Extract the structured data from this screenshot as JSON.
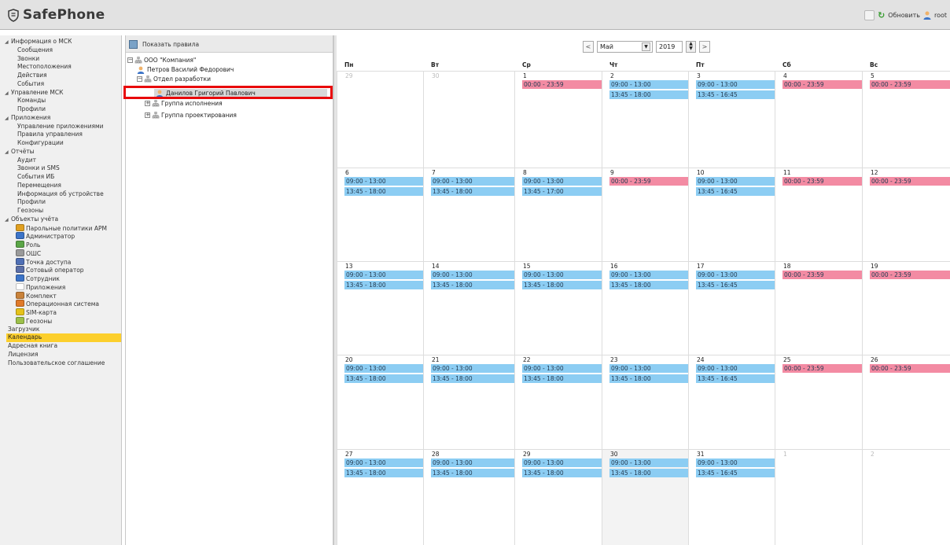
{
  "app": {
    "title": "SafePhone"
  },
  "header": {
    "refresh_label": "Обновить",
    "user_label": "root"
  },
  "nav": {
    "items": [
      {
        "label": "Информация о МСК",
        "kind": "section"
      },
      {
        "label": "Сообщения",
        "kind": "child"
      },
      {
        "label": "Звонки",
        "kind": "child"
      },
      {
        "label": "Местоположения",
        "kind": "child"
      },
      {
        "label": "Действия",
        "kind": "child"
      },
      {
        "label": "События",
        "kind": "child"
      },
      {
        "label": "Управление МСК",
        "kind": "section"
      },
      {
        "label": "Команды",
        "kind": "child"
      },
      {
        "label": "Профили",
        "kind": "child"
      },
      {
        "label": "Приложения",
        "kind": "section"
      },
      {
        "label": "Управление приложениями",
        "kind": "child"
      },
      {
        "label": "Правила управления",
        "kind": "child"
      },
      {
        "label": "Конфигурации",
        "kind": "child"
      },
      {
        "label": "Отчёты",
        "kind": "section"
      },
      {
        "label": "Аудит",
        "kind": "child"
      },
      {
        "label": "Звонки и SMS",
        "kind": "child"
      },
      {
        "label": "События ИБ",
        "kind": "child"
      },
      {
        "label": "Перемещения",
        "kind": "child"
      },
      {
        "label": "Информация об устройстве",
        "kind": "child"
      },
      {
        "label": "Профили",
        "kind": "child"
      },
      {
        "label": "Геозоны",
        "kind": "child"
      },
      {
        "label": "Объекты учёта",
        "kind": "section"
      },
      {
        "label": "Парольные политики АРМ",
        "kind": "child-icon",
        "icon": "lock-icon"
      },
      {
        "label": "Администратор",
        "kind": "child-icon",
        "icon": "admin-icon"
      },
      {
        "label": "Роль",
        "kind": "child-icon",
        "icon": "role-icon"
      },
      {
        "label": "ОШС",
        "kind": "child-icon",
        "icon": "org-structure-icon"
      },
      {
        "label": "Точка доступа",
        "kind": "child-icon",
        "icon": "access-point-icon"
      },
      {
        "label": "Сотовый оператор",
        "kind": "child-icon",
        "icon": "cell-operator-icon"
      },
      {
        "label": "Сотрудник",
        "kind": "child-icon",
        "icon": "employee-icon"
      },
      {
        "label": "Приложения",
        "kind": "child-icon",
        "icon": "application-icon"
      },
      {
        "label": "Комплект",
        "kind": "child-icon",
        "icon": "kit-icon"
      },
      {
        "label": "Операционная система",
        "kind": "child-icon",
        "icon": "os-icon"
      },
      {
        "label": "SIM-карта",
        "kind": "child-icon",
        "icon": "sim-card-icon"
      },
      {
        "label": "Геозоны",
        "kind": "child-icon",
        "icon": "geozone-icon"
      },
      {
        "label": "Загрузчик",
        "kind": "top"
      },
      {
        "label": "Календарь",
        "kind": "top",
        "active": true
      },
      {
        "label": "Адресная книга",
        "kind": "top"
      },
      {
        "label": "Лицензия",
        "kind": "top"
      },
      {
        "label": "Пользовательское соглашение",
        "kind": "top"
      }
    ]
  },
  "tree": {
    "show_rules_label": "Показать правила",
    "nodes": [
      {
        "label": "ООО \"Компания\"",
        "type": "org",
        "expander": "⊟"
      },
      {
        "label": "Петров Василий Федорович",
        "type": "person"
      },
      {
        "label": "Отдел разработки",
        "type": "org",
        "expander": "⊟"
      },
      {
        "label": "Данилов Григорий Павлович",
        "type": "person",
        "selected": true
      },
      {
        "label": "Группа исполнения",
        "type": "org",
        "expander": "⊞"
      },
      {
        "label": "Группа проектирования",
        "type": "org",
        "expander": "⊞"
      }
    ]
  },
  "calendar": {
    "prev_label": "<",
    "next_label": ">",
    "month": "Май",
    "year": "2019",
    "weekdays": [
      "Пн",
      "Вт",
      "Ср",
      "Чт",
      "Пт",
      "Сб",
      "Вс"
    ],
    "weeks": [
      [
        {
          "day": "29",
          "muted": true,
          "slots": []
        },
        {
          "day": "30",
          "muted": true,
          "slots": []
        },
        {
          "day": "1",
          "slots": [
            {
              "t": "00:00 - 23:59",
              "c": "pink"
            }
          ]
        },
        {
          "day": "2",
          "slots": [
            {
              "t": "09:00 - 13:00",
              "c": "blue"
            },
            {
              "t": "13:45 - 18:00",
              "c": "blue"
            }
          ]
        },
        {
          "day": "3",
          "slots": [
            {
              "t": "09:00 - 13:00",
              "c": "blue"
            },
            {
              "t": "13:45 - 16:45",
              "c": "blue"
            }
          ]
        },
        {
          "day": "4",
          "slots": [
            {
              "t": "00:00 - 23:59",
              "c": "pink"
            }
          ]
        },
        {
          "day": "5",
          "slots": [
            {
              "t": "00:00 - 23:59",
              "c": "pink"
            }
          ]
        }
      ],
      [
        {
          "day": "6",
          "slots": [
            {
              "t": "09:00 - 13:00",
              "c": "blue"
            },
            {
              "t": "13:45 - 18:00",
              "c": "blue"
            }
          ]
        },
        {
          "day": "7",
          "slots": [
            {
              "t": "09:00 - 13:00",
              "c": "blue"
            },
            {
              "t": "13:45 - 18:00",
              "c": "blue"
            }
          ]
        },
        {
          "day": "8",
          "slots": [
            {
              "t": "09:00 - 13:00",
              "c": "blue"
            },
            {
              "t": "13:45 - 17:00",
              "c": "blue"
            }
          ]
        },
        {
          "day": "9",
          "slots": [
            {
              "t": "00:00 - 23:59",
              "c": "pink"
            }
          ]
        },
        {
          "day": "10",
          "slots": [
            {
              "t": "09:00 - 13:00",
              "c": "blue"
            },
            {
              "t": "13:45 - 16:45",
              "c": "blue"
            }
          ]
        },
        {
          "day": "11",
          "slots": [
            {
              "t": "00:00 - 23:59",
              "c": "pink"
            }
          ]
        },
        {
          "day": "12",
          "slots": [
            {
              "t": "00:00 - 23:59",
              "c": "pink"
            }
          ]
        }
      ],
      [
        {
          "day": "13",
          "slots": [
            {
              "t": "09:00 - 13:00",
              "c": "blue"
            },
            {
              "t": "13:45 - 18:00",
              "c": "blue"
            }
          ]
        },
        {
          "day": "14",
          "slots": [
            {
              "t": "09:00 - 13:00",
              "c": "blue"
            },
            {
              "t": "13:45 - 18:00",
              "c": "blue"
            }
          ]
        },
        {
          "day": "15",
          "slots": [
            {
              "t": "09:00 - 13:00",
              "c": "blue"
            },
            {
              "t": "13:45 - 18:00",
              "c": "blue"
            }
          ]
        },
        {
          "day": "16",
          "slots": [
            {
              "t": "09:00 - 13:00",
              "c": "blue"
            },
            {
              "t": "13:45 - 18:00",
              "c": "blue"
            }
          ]
        },
        {
          "day": "17",
          "slots": [
            {
              "t": "09:00 - 13:00",
              "c": "blue"
            },
            {
              "t": "13:45 - 16:45",
              "c": "blue"
            }
          ]
        },
        {
          "day": "18",
          "slots": [
            {
              "t": "00:00 - 23:59",
              "c": "pink"
            }
          ]
        },
        {
          "day": "19",
          "slots": [
            {
              "t": "00:00 - 23:59",
              "c": "pink"
            }
          ]
        }
      ],
      [
        {
          "day": "20",
          "slots": [
            {
              "t": "09:00 - 13:00",
              "c": "blue"
            },
            {
              "t": "13:45 - 18:00",
              "c": "blue"
            }
          ]
        },
        {
          "day": "21",
          "slots": [
            {
              "t": "09:00 - 13:00",
              "c": "blue"
            },
            {
              "t": "13:45 - 18:00",
              "c": "blue"
            }
          ]
        },
        {
          "day": "22",
          "slots": [
            {
              "t": "09:00 - 13:00",
              "c": "blue"
            },
            {
              "t": "13:45 - 18:00",
              "c": "blue"
            }
          ]
        },
        {
          "day": "23",
          "slots": [
            {
              "t": "09:00 - 13:00",
              "c": "blue"
            },
            {
              "t": "13:45 - 18:00",
              "c": "blue"
            }
          ]
        },
        {
          "day": "24",
          "slots": [
            {
              "t": "09:00 - 13:00",
              "c": "blue"
            },
            {
              "t": "13:45 - 16:45",
              "c": "blue"
            }
          ]
        },
        {
          "day": "25",
          "slots": [
            {
              "t": "00:00 - 23:59",
              "c": "pink"
            }
          ]
        },
        {
          "day": "26",
          "slots": [
            {
              "t": "00:00 - 23:59",
              "c": "pink"
            }
          ]
        }
      ],
      [
        {
          "day": "27",
          "slots": [
            {
              "t": "09:00 - 13:00",
              "c": "blue"
            },
            {
              "t": "13:45 - 18:00",
              "c": "blue"
            }
          ]
        },
        {
          "day": "28",
          "slots": [
            {
              "t": "09:00 - 13:00",
              "c": "blue"
            },
            {
              "t": "13:45 - 18:00",
              "c": "blue"
            }
          ]
        },
        {
          "day": "29",
          "slots": [
            {
              "t": "09:00 - 13:00",
              "c": "blue"
            },
            {
              "t": "13:45 - 18:00",
              "c": "blue"
            }
          ]
        },
        {
          "day": "30",
          "today": true,
          "slots": [
            {
              "t": "09:00 - 13:00",
              "c": "blue"
            },
            {
              "t": "13:45 - 18:00",
              "c": "blue"
            }
          ]
        },
        {
          "day": "31",
          "slots": [
            {
              "t": "09:00 - 13:00",
              "c": "blue"
            },
            {
              "t": "13:45 - 16:45",
              "c": "blue"
            }
          ]
        },
        {
          "day": "1",
          "muted": true,
          "slots": []
        },
        {
          "day": "2",
          "muted": true,
          "slots": []
        }
      ]
    ]
  },
  "colors": {
    "active_nav": "#fccf2c",
    "work_slot": "#8ccdf3",
    "off_slot": "#f38ba3",
    "selection_frame": "#e8090b"
  }
}
